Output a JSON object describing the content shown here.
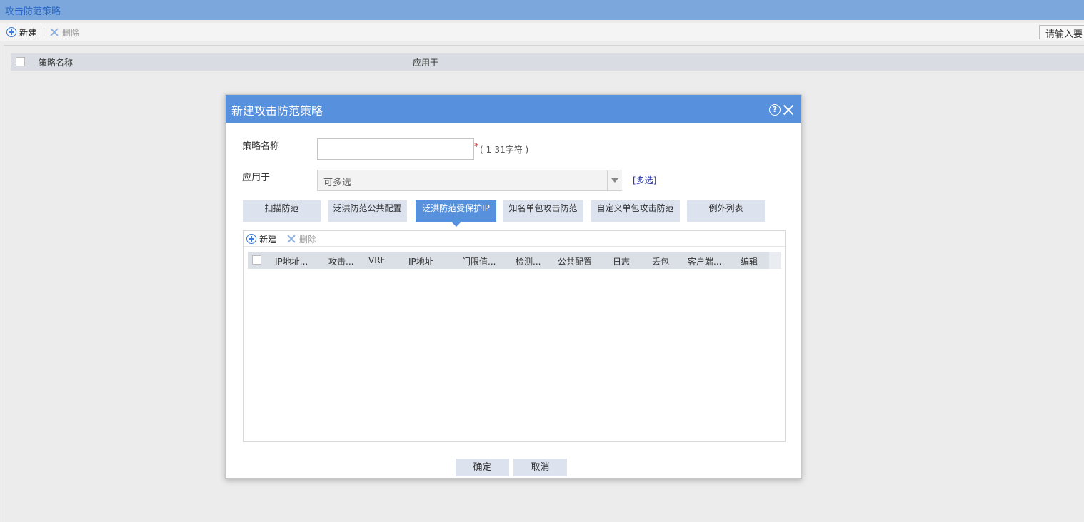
{
  "page": {
    "title": "攻击防范策略"
  },
  "toolbar": {
    "new_label": "新建",
    "delete_label": "删除",
    "search_placeholder": "请输入要"
  },
  "main_table": {
    "columns": [
      "策略名称",
      "应用于"
    ]
  },
  "dialog": {
    "title": "新建攻击防范策略",
    "help_glyph": "?",
    "name_label": "策略名称",
    "name_value": "",
    "required_mark": "*",
    "name_hint": "( 1-31字符 )",
    "apply_label": "应用于",
    "apply_placeholder": "可多选",
    "multi_select_link": "[多选]",
    "tabs": [
      {
        "label": "扫描防范",
        "active": false
      },
      {
        "label": "泛洪防范公共配置",
        "active": false
      },
      {
        "label": "泛洪防范受保护IP",
        "active": true
      },
      {
        "label": "知名单包攻击防范",
        "active": false
      },
      {
        "label": "自定义单包攻击防范",
        "active": false
      },
      {
        "label": "例外列表",
        "active": false
      }
    ],
    "sub_toolbar": {
      "new_label": "新建",
      "delete_label": "删除"
    },
    "grid_columns": [
      "IP地址...",
      "攻击...",
      "VRF",
      "IP地址",
      "门限值...",
      "检测...",
      "公共配置",
      "日志",
      "丢包",
      "客户端...",
      "编辑"
    ],
    "ok_label": "确定",
    "cancel_label": "取消"
  },
  "colors": {
    "accent": "#5790dc",
    "titlebar": "#7ba7dc",
    "tab_bg": "#dce3ef"
  }
}
